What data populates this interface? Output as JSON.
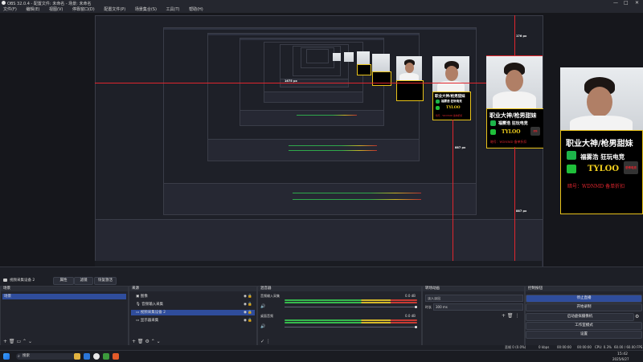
{
  "window": {
    "title": "OBS 32.0.4 - 配置文件: 未命名 - 场景: 未命名",
    "controls": [
      "—",
      "□",
      "✕"
    ]
  },
  "menu": [
    "文件(F)",
    "编辑(E)",
    "视图(V)",
    "停靠窗口(D)",
    "配置文件(P)",
    "场景集合(S)",
    "工具(T)",
    "帮助(H)"
  ],
  "preview": {
    "guide_labels": [
      "176 px",
      "1675 px",
      "887 px",
      "887 px"
    ],
    "card": {
      "title": "职业大神/枪男甜妹",
      "wechat": "福雾浩 狂玩电竞",
      "team": "TYLOO",
      "footer": "暗号：WDNMD 备单折扣",
      "logo": "恐怖电竞"
    }
  },
  "scene_toolbar": {
    "source_name": "视频采集设备 2",
    "buttons": [
      "属性",
      "滤镜",
      "恢复激活"
    ]
  },
  "scenes": {
    "header": "场景",
    "items": [
      "场景"
    ]
  },
  "sources": {
    "header": "来源",
    "items": [
      {
        "name": "图像",
        "icon": "image-icon"
      },
      {
        "name": "音频输入采集",
        "icon": "mic-icon"
      },
      {
        "name": "视频采集设备 2",
        "icon": "camera-icon"
      },
      {
        "name": "显示器采集",
        "icon": "monitor-icon"
      }
    ],
    "selected_index": 2
  },
  "mixer": {
    "header": "混音器",
    "channels": [
      {
        "name": "音频输入采集",
        "db": "0.0 dB"
      },
      {
        "name": "桌面音频",
        "db": "0.0 dB"
      }
    ]
  },
  "transitions": {
    "header": "转场动画",
    "type": "淡入淡出",
    "duration_label": "时长",
    "duration": "300 ms"
  },
  "controls": {
    "header": "控制按钮",
    "buttons": [
      "停止直播",
      "开始录制",
      "启动虚拟摄像机",
      "工作室模式",
      "设置"
    ]
  },
  "status": {
    "items": [
      "丢帧 0 (0.0%)",
      "0 kbps",
      "00:00:00",
      "00:00:00",
      "CPU: 0.3%",
      "60.00 / 60.00 FPS"
    ]
  },
  "taskbar": {
    "search": "搜索",
    "time": "15:42",
    "date": "2025/6/27"
  },
  "colors": {
    "accent": "#2f4d9c",
    "guide": "#e0262e",
    "card_border": "#e8c21a"
  }
}
